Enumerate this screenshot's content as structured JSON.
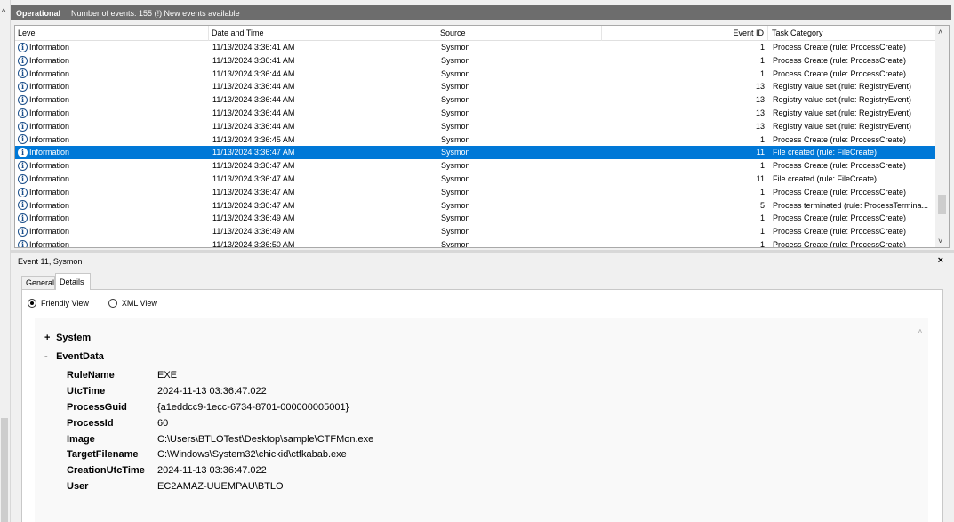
{
  "header": {
    "title": "Operational",
    "info": "Number of events: 155 (!) New events available"
  },
  "columns": {
    "level": "Level",
    "date": "Date and Time",
    "source": "Source",
    "event_id": "Event ID",
    "task_category": "Task Category"
  },
  "rows": [
    {
      "level": "Information",
      "date": "11/13/2024 3:36:41 AM",
      "source": "Sysmon",
      "event_id": "1",
      "category": "Process Create (rule: ProcessCreate)"
    },
    {
      "level": "Information",
      "date": "11/13/2024 3:36:41 AM",
      "source": "Sysmon",
      "event_id": "1",
      "category": "Process Create (rule: ProcessCreate)"
    },
    {
      "level": "Information",
      "date": "11/13/2024 3:36:44 AM",
      "source": "Sysmon",
      "event_id": "1",
      "category": "Process Create (rule: ProcessCreate)"
    },
    {
      "level": "Information",
      "date": "11/13/2024 3:36:44 AM",
      "source": "Sysmon",
      "event_id": "13",
      "category": "Registry value set (rule: RegistryEvent)"
    },
    {
      "level": "Information",
      "date": "11/13/2024 3:36:44 AM",
      "source": "Sysmon",
      "event_id": "13",
      "category": "Registry value set (rule: RegistryEvent)"
    },
    {
      "level": "Information",
      "date": "11/13/2024 3:36:44 AM",
      "source": "Sysmon",
      "event_id": "13",
      "category": "Registry value set (rule: RegistryEvent)"
    },
    {
      "level": "Information",
      "date": "11/13/2024 3:36:44 AM",
      "source": "Sysmon",
      "event_id": "13",
      "category": "Registry value set (rule: RegistryEvent)"
    },
    {
      "level": "Information",
      "date": "11/13/2024 3:36:45 AM",
      "source": "Sysmon",
      "event_id": "1",
      "category": "Process Create (rule: ProcessCreate)"
    },
    {
      "level": "Information",
      "date": "11/13/2024 3:36:47 AM",
      "source": "Sysmon",
      "event_id": "11",
      "category": "File created (rule: FileCreate)",
      "selected": true
    },
    {
      "level": "Information",
      "date": "11/13/2024 3:36:47 AM",
      "source": "Sysmon",
      "event_id": "1",
      "category": "Process Create (rule: ProcessCreate)"
    },
    {
      "level": "Information",
      "date": "11/13/2024 3:36:47 AM",
      "source": "Sysmon",
      "event_id": "11",
      "category": "File created (rule: FileCreate)"
    },
    {
      "level": "Information",
      "date": "11/13/2024 3:36:47 AM",
      "source": "Sysmon",
      "event_id": "1",
      "category": "Process Create (rule: ProcessCreate)"
    },
    {
      "level": "Information",
      "date": "11/13/2024 3:36:47 AM",
      "source": "Sysmon",
      "event_id": "5",
      "category": "Process terminated (rule: ProcessTermina..."
    },
    {
      "level": "Information",
      "date": "11/13/2024 3:36:49 AM",
      "source": "Sysmon",
      "event_id": "1",
      "category": "Process Create (rule: ProcessCreate)"
    },
    {
      "level": "Information",
      "date": "11/13/2024 3:36:49 AM",
      "source": "Sysmon",
      "event_id": "1",
      "category": "Process Create (rule: ProcessCreate)"
    },
    {
      "level": "Information",
      "date": "11/13/2024 3:36:50 AM",
      "source": "Sysmon",
      "event_id": "1",
      "category": "Process Create (rule: ProcessCreate)"
    }
  ],
  "detail": {
    "title": "Event 11, Sysmon",
    "close": "×",
    "tabs": {
      "general": "General",
      "details": "Details"
    },
    "views": {
      "friendly": "Friendly View",
      "xml": "XML View"
    },
    "system_label": "System",
    "system_sign": "+",
    "eventdata_label": "EventData",
    "eventdata_sign": "-",
    "fields": [
      {
        "key": "RuleName",
        "value": "EXE"
      },
      {
        "key": "UtcTime",
        "value": "2024-11-13 03:36:47.022"
      },
      {
        "key": "ProcessGuid",
        "value": "{a1eddcc9-1ecc-6734-8701-000000005001}"
      },
      {
        "key": "ProcessId",
        "value": "60"
      },
      {
        "key": "Image",
        "value": "C:\\Users\\BTLOTest\\Desktop\\sample\\CTFMon.exe"
      },
      {
        "key": "TargetFilename",
        "value": "C:\\Windows\\System32\\chickid\\ctfkabab.exe"
      },
      {
        "key": "CreationUtcTime",
        "value": "2024-11-13 03:36:47.022"
      },
      {
        "key": "User",
        "value": "EC2AMAZ-UUEMPAU\\BTLO"
      }
    ]
  },
  "icons": {
    "info": "info-icon",
    "scroll_up": "chevron-up-icon",
    "scroll_down": "chevron-down-icon",
    "close": "close-icon"
  },
  "colors": {
    "header_bg": "#6d6d6d",
    "selection": "#0078d7",
    "info_icon": "#1a4e8a"
  }
}
